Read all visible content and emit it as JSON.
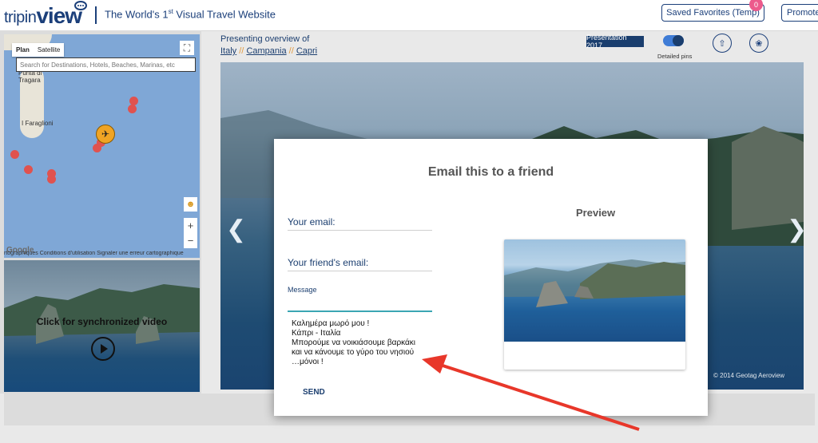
{
  "header": {
    "logo_trip": "tripin",
    "logo_view": "view",
    "tagline_pre": "The World's 1",
    "tagline_sup": "st",
    "tagline_post": " Visual Travel Website",
    "saved_favorites_label": "Saved Favorites (Temp)",
    "saved_favorites_count": "0",
    "promote_label": "Promote"
  },
  "map": {
    "tab_plan": "Plan",
    "tab_satellite": "Satellite",
    "search_placeholder": "Search for Destinations, Hotels, Beaches, Marinas, etc",
    "label_punta": "Punta di\nTragara",
    "label_faraglioni": "I Faraglioni",
    "zoom_in": "+",
    "zoom_out": "−",
    "google": "Google",
    "footer": "rtographiques   Conditions d'utilisation   Signaler une erreur cartographique"
  },
  "video": {
    "label": "Click for synchronized video"
  },
  "presentation": {
    "overview_label": "Presenting overview of",
    "crumbs": [
      "Italy",
      "Campania",
      "Capri"
    ],
    "separator": "//",
    "year_button": "Presentation 2017",
    "detailed_pins_label": "Detailed pins",
    "copyright": "© 2014 Geotag Aeroview"
  },
  "modal": {
    "title": "Email this to a friend",
    "your_email_label": "Your email:",
    "friend_email_label": "Your friend's email:",
    "message_label": "Message",
    "message_text": "Καλημέρα μωρό μου !\nΚάπρι - Ιταλία\nΜπορούμε να νοικιάσουμε βαρκάκι\nκαι να κάνουμε το γύρο του νησιού\n…μόνοι !",
    "send_label": "SEND",
    "preview_title": "Preview"
  },
  "colors": {
    "brand": "#1b3f7a",
    "accent_teal": "#3ba6b3",
    "badge": "#ec5a8c",
    "arrow": "#e8372a"
  }
}
